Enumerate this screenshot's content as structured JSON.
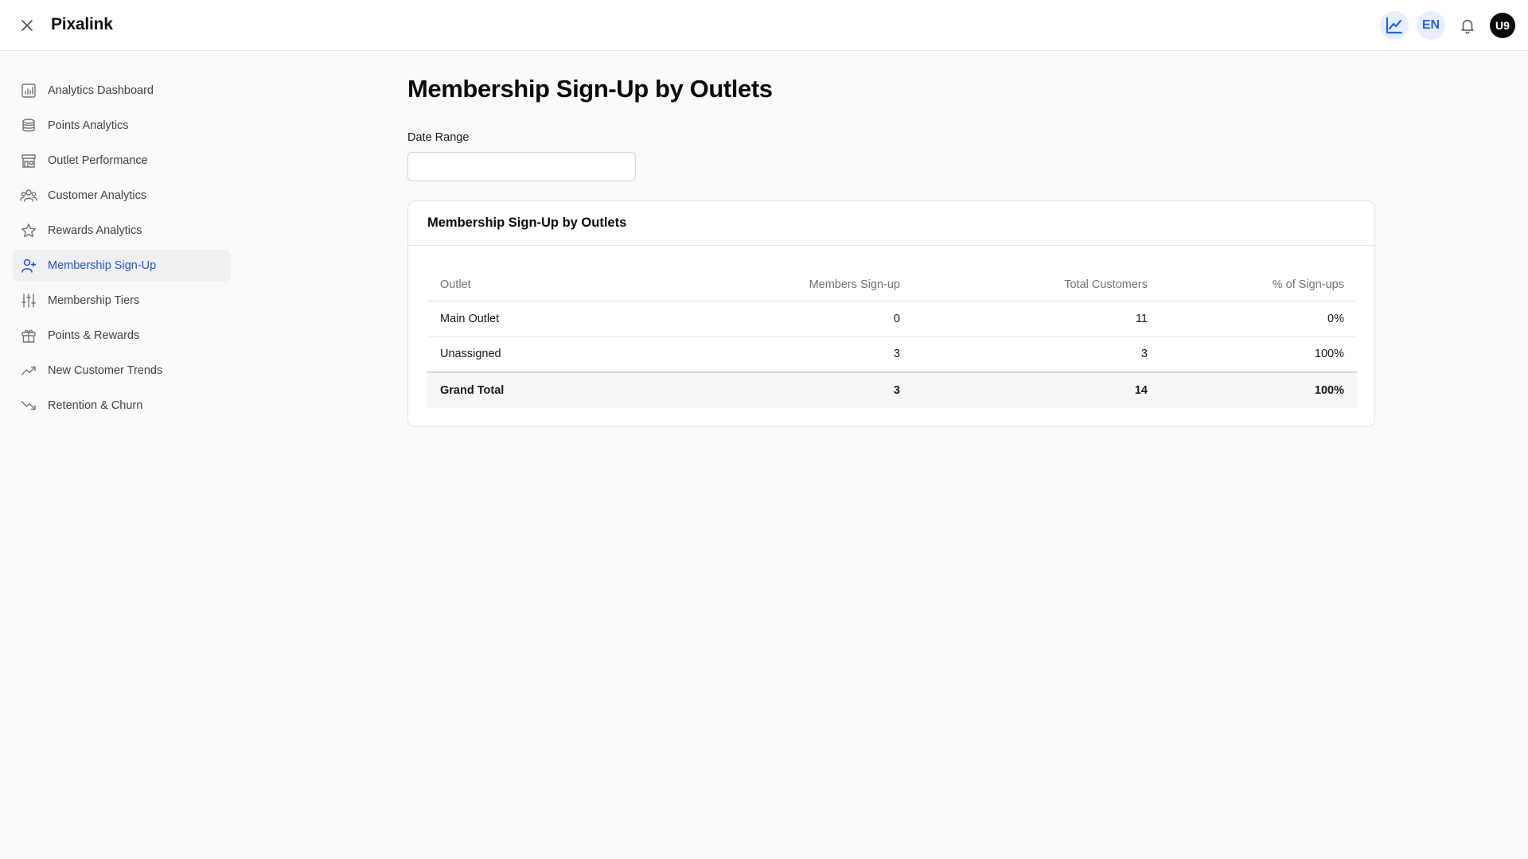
{
  "app": {
    "brand": "Pixalink"
  },
  "header": {
    "language": "EN",
    "avatar_initials": "U9"
  },
  "sidebar": {
    "items": [
      {
        "label": "Analytics Dashboard",
        "icon": "bar-chart-icon"
      },
      {
        "label": "Points Analytics",
        "icon": "database-icon"
      },
      {
        "label": "Outlet Performance",
        "icon": "store-icon"
      },
      {
        "label": "Customer Analytics",
        "icon": "users-icon"
      },
      {
        "label": "Rewards Analytics",
        "icon": "star-icon"
      },
      {
        "label": "Membership Sign-Up",
        "icon": "user-plus-icon",
        "active": true
      },
      {
        "label": "Membership Tiers",
        "icon": "sliders-icon"
      },
      {
        "label": "Points & Rewards",
        "icon": "gift-icon"
      },
      {
        "label": "New Customer Trends",
        "icon": "trending-up-icon"
      },
      {
        "label": "Retention & Churn",
        "icon": "trending-down-icon"
      }
    ]
  },
  "main": {
    "title": "Membership Sign-Up by Outlets",
    "date_range": {
      "label": "Date Range",
      "value": ""
    },
    "card": {
      "title": "Membership Sign-Up by Outlets",
      "columns": [
        "Outlet",
        "Members Sign-up",
        "Total Customers",
        "% of Sign-ups"
      ],
      "rows": [
        [
          "Main Outlet",
          "0",
          "11",
          "0%"
        ],
        [
          "Unassigned",
          "3",
          "3",
          "100%"
        ]
      ],
      "total": [
        "Grand Total",
        "3",
        "14",
        "100%"
      ]
    }
  },
  "colors": {
    "accent": "#2463eb",
    "active_nav_text": "#2451c8",
    "active_nav_bg": "#f0f0f2"
  }
}
